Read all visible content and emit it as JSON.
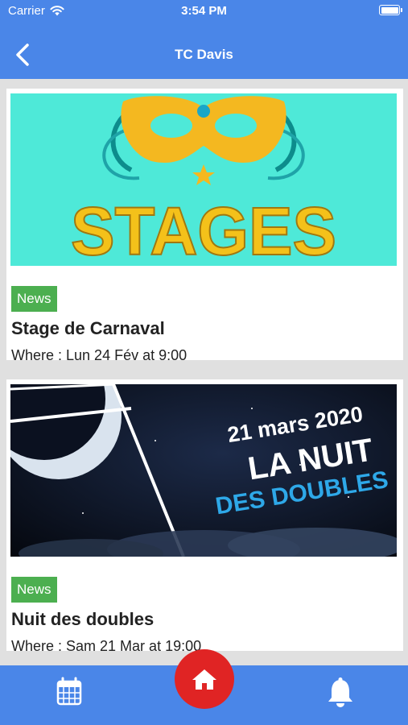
{
  "status_bar": {
    "carrier": "Carrier",
    "time": "3:54 PM"
  },
  "nav": {
    "title": "TC Davis",
    "back_icon": "chevron-left-icon"
  },
  "feed": {
    "items": [
      {
        "badge": "News",
        "title": "Stage de Carnaval",
        "where": "Where : Lun 24 Fév at 9:00",
        "image": {
          "text": "STAGES",
          "background": "#4ee9d8"
        }
      },
      {
        "badge": "News",
        "title": "Nuit des doubles",
        "where": "Where : Sam 21 Mar at 19:00",
        "image": {
          "date": "21 mars 2020",
          "line1": "LA NUIT",
          "line2": "DES DOUBLES"
        }
      }
    ]
  },
  "tab_bar": {
    "calendar_icon": "calendar-icon",
    "home_icon": "home-icon",
    "notifications_icon": "bell-icon"
  },
  "colors": {
    "primary": "#4a86e8",
    "badge": "#4caf50",
    "home_button": "#e02424",
    "background": "#e0e0e0"
  }
}
